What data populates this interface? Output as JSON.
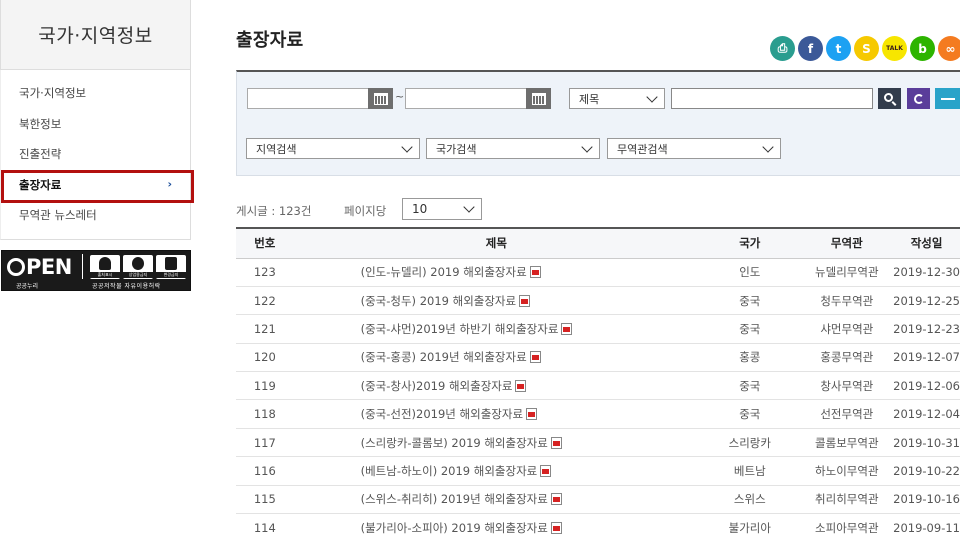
{
  "sidebar": {
    "title": "국가·지역정보",
    "items": [
      {
        "label": "국가·지역정보"
      },
      {
        "label": "북한정보"
      },
      {
        "label": "진출전략"
      },
      {
        "label": "출장자료",
        "chevron": "›"
      },
      {
        "label": "무역관 뉴스레터"
      }
    ]
  },
  "license": {
    "open": "PEN",
    "sub1": "공공누리",
    "sub2": "공공저작물 자유이용허락",
    "cells": [
      "출처표시",
      "상업용금지",
      "변경금지"
    ]
  },
  "page": {
    "title": "출장자료"
  },
  "social": [
    {
      "icon": "print-icon",
      "glyph": "⎙",
      "color": "#2a9d8f"
    },
    {
      "icon": "facebook-icon",
      "glyph": "f",
      "color": "#3b5998"
    },
    {
      "icon": "twitter-icon",
      "glyph": "t",
      "color": "#1da1f2"
    },
    {
      "icon": "kakaostory-icon",
      "glyph": "S",
      "color": "#f6c900"
    },
    {
      "icon": "kakaotalk-icon",
      "glyph": "TALK",
      "color": "#f7e600"
    },
    {
      "icon": "blog-icon",
      "glyph": "b",
      "color": "#2db400"
    },
    {
      "icon": "link-icon",
      "glyph": "∞",
      "color": "#f47b20"
    }
  ],
  "search": {
    "date_from": "",
    "date_to": "",
    "tilde": "~",
    "field_select": "제목",
    "keyword": "",
    "region_select": "지역검색",
    "country_select": "국가검색",
    "office_select": "무역관검색"
  },
  "list": {
    "count_label": "게시글 : 123건",
    "perpage_label": "페이지당",
    "perpage_value": "10"
  },
  "table": {
    "headers": [
      "번호",
      "제목",
      "국가",
      "무역관",
      "작성일"
    ],
    "rows": [
      {
        "no": "123",
        "title": "(인도-뉴델리) 2019 해외출장자료",
        "country": "인도",
        "office": "뉴델리무역관",
        "date": "2019-12-30"
      },
      {
        "no": "122",
        "title": "(중국-청두) 2019 해외출장자료",
        "country": "중국",
        "office": "청두무역관",
        "date": "2019-12-25"
      },
      {
        "no": "121",
        "title": "(중국-샤먼)2019년 하반기 해외출장자료",
        "country": "중국",
        "office": "샤먼무역관",
        "date": "2019-12-23"
      },
      {
        "no": "120",
        "title": "(중국-홍콩) 2019년 해외출장자료",
        "country": "홍콩",
        "office": "홍콩무역관",
        "date": "2019-12-07"
      },
      {
        "no": "119",
        "title": "(중국-창사)2019 해외출장자료",
        "country": "중국",
        "office": "창사무역관",
        "date": "2019-12-06"
      },
      {
        "no": "118",
        "title": "(중국-선전)2019년 해외출장자료",
        "country": "중국",
        "office": "선전무역관",
        "date": "2019-12-04"
      },
      {
        "no": "117",
        "title": "(스리랑카-콜롬보) 2019 해외출장자료",
        "country": "스리랑카",
        "office": "콜롬보무역관",
        "date": "2019-10-31"
      },
      {
        "no": "116",
        "title": "(베트남-하노이) 2019 해외출장자료",
        "country": "베트남",
        "office": "하노이무역관",
        "date": "2019-10-22"
      },
      {
        "no": "115",
        "title": "(스위스-취리히) 2019년 해외출장자료",
        "country": "스위스",
        "office": "취리히무역관",
        "date": "2019-10-16"
      },
      {
        "no": "114",
        "title": "(불가리아-소피아) 2019 해외출장자료",
        "country": "불가리아",
        "office": "소피아무역관",
        "date": "2019-09-11"
      }
    ]
  }
}
